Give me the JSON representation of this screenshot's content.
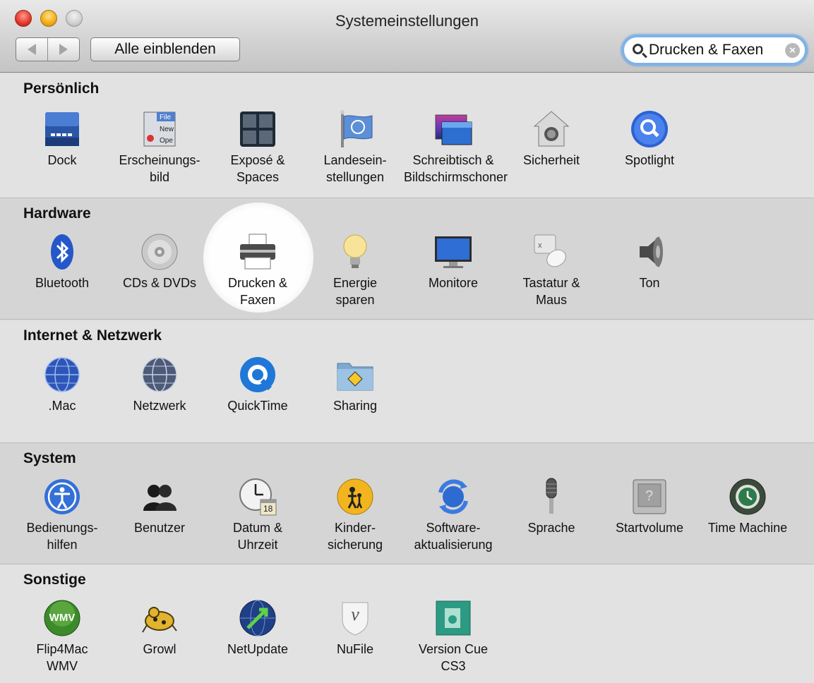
{
  "window": {
    "title": "Systemeinstellungen"
  },
  "toolbar": {
    "back_icon": "back-arrow",
    "forward_icon": "forward-arrow",
    "show_all_label": "Alle einblenden",
    "search_value": "Drucken & Faxen"
  },
  "highlight_color": "#ffffff",
  "sections": [
    {
      "title": "Persönlich",
      "items": [
        {
          "label": "Dock",
          "icon": "dock-icon"
        },
        {
          "label": "Erscheinungs-\nbild",
          "icon": "appearance-icon"
        },
        {
          "label": "Exposé &\nSpaces",
          "icon": "expose-icon"
        },
        {
          "label": "Landesein-\nstellungen",
          "icon": "international-icon"
        },
        {
          "label": "Schreibtisch &\nBildschirmschoner",
          "icon": "desktop-icon"
        },
        {
          "label": "Sicherheit",
          "icon": "security-icon"
        },
        {
          "label": "Spotlight",
          "icon": "spotlight-icon"
        }
      ]
    },
    {
      "title": "Hardware",
      "items": [
        {
          "label": "Bluetooth",
          "icon": "bluetooth-icon"
        },
        {
          "label": "CDs & DVDs",
          "icon": "cd-icon"
        },
        {
          "label": "Drucken &\nFaxen",
          "icon": "printer-icon",
          "highlighted": true
        },
        {
          "label": "Energie\nsparen",
          "icon": "lightbulb-icon"
        },
        {
          "label": "Monitore",
          "icon": "monitor-icon"
        },
        {
          "label": "Tastatur &\nMaus",
          "icon": "keyboard-mouse-icon"
        },
        {
          "label": "Ton",
          "icon": "speaker-icon"
        }
      ]
    },
    {
      "title": "Internet & Netzwerk",
      "items": [
        {
          "label": ".Mac",
          "icon": "mac-globe-icon"
        },
        {
          "label": "Netzwerk",
          "icon": "network-globe-icon"
        },
        {
          "label": "QuickTime",
          "icon": "quicktime-icon"
        },
        {
          "label": "Sharing",
          "icon": "sharing-folder-icon"
        }
      ]
    },
    {
      "title": "System",
      "items": [
        {
          "label": "Bedienungs-\nhilfen",
          "icon": "accessibility-icon"
        },
        {
          "label": "Benutzer",
          "icon": "users-icon"
        },
        {
          "label": "Datum &\nUhrzeit",
          "icon": "clock-icon",
          "badge": "18"
        },
        {
          "label": "Kinder-\nsicherung",
          "icon": "parental-controls-icon"
        },
        {
          "label": "Software-\naktualisierung",
          "icon": "software-update-icon"
        },
        {
          "label": "Sprache",
          "icon": "microphone-icon"
        },
        {
          "label": "Startvolume",
          "icon": "startup-disk-icon"
        },
        {
          "label": "Time Machine",
          "icon": "time-machine-icon"
        }
      ]
    },
    {
      "title": "Sonstige",
      "items": [
        {
          "label": "Flip4Mac\nWMV",
          "icon": "wmv-icon",
          "badge": "WMV"
        },
        {
          "label": "Growl",
          "icon": "growl-icon"
        },
        {
          "label": "NetUpdate",
          "icon": "netupdate-icon"
        },
        {
          "label": "NuFile",
          "icon": "nufile-icon",
          "badge": "v"
        },
        {
          "label": "Version Cue\nCS3",
          "icon": "version-cue-icon"
        }
      ]
    }
  ]
}
